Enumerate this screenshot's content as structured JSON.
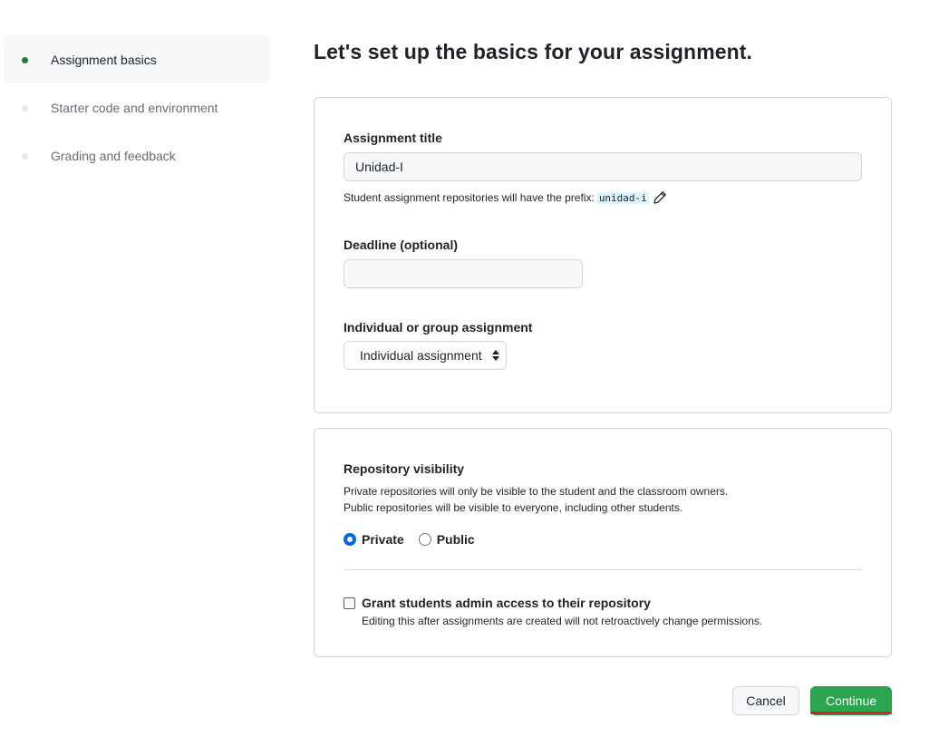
{
  "sidebar": {
    "steps": [
      {
        "label": "Assignment basics",
        "active": true
      },
      {
        "label": "Starter code and environment",
        "active": false
      },
      {
        "label": "Grading and feedback",
        "active": false
      }
    ]
  },
  "heading": "Let's set up the basics for your assignment.",
  "basics": {
    "title_label": "Assignment title",
    "title_value": "Unidad-I",
    "prefix_hint": "Student assignment repositories will have the prefix:",
    "prefix_value": "unidad-i",
    "deadline_label": "Deadline (optional)",
    "deadline_value": "",
    "type_label": "Individual or group assignment",
    "type_selected": "Individual assignment"
  },
  "visibility": {
    "label": "Repository visibility",
    "desc_private": "Private repositories will only be visible to the student and the classroom owners.",
    "desc_public": "Public repositories will be visible to everyone, including other students.",
    "option_private": "Private",
    "option_public": "Public",
    "selected": "Private",
    "admin_label": "Grant students admin access to their repository",
    "admin_note": "Editing this after assignments are created will not retroactively change permissions.",
    "admin_checked": false
  },
  "footer": {
    "cancel_label": "Cancel",
    "continue_label": "Continue"
  },
  "colors": {
    "accent_green": "#2da44e",
    "active_dot": "#1a7f37",
    "radio_blue": "#0969da",
    "underline_red": "#cf222e"
  }
}
